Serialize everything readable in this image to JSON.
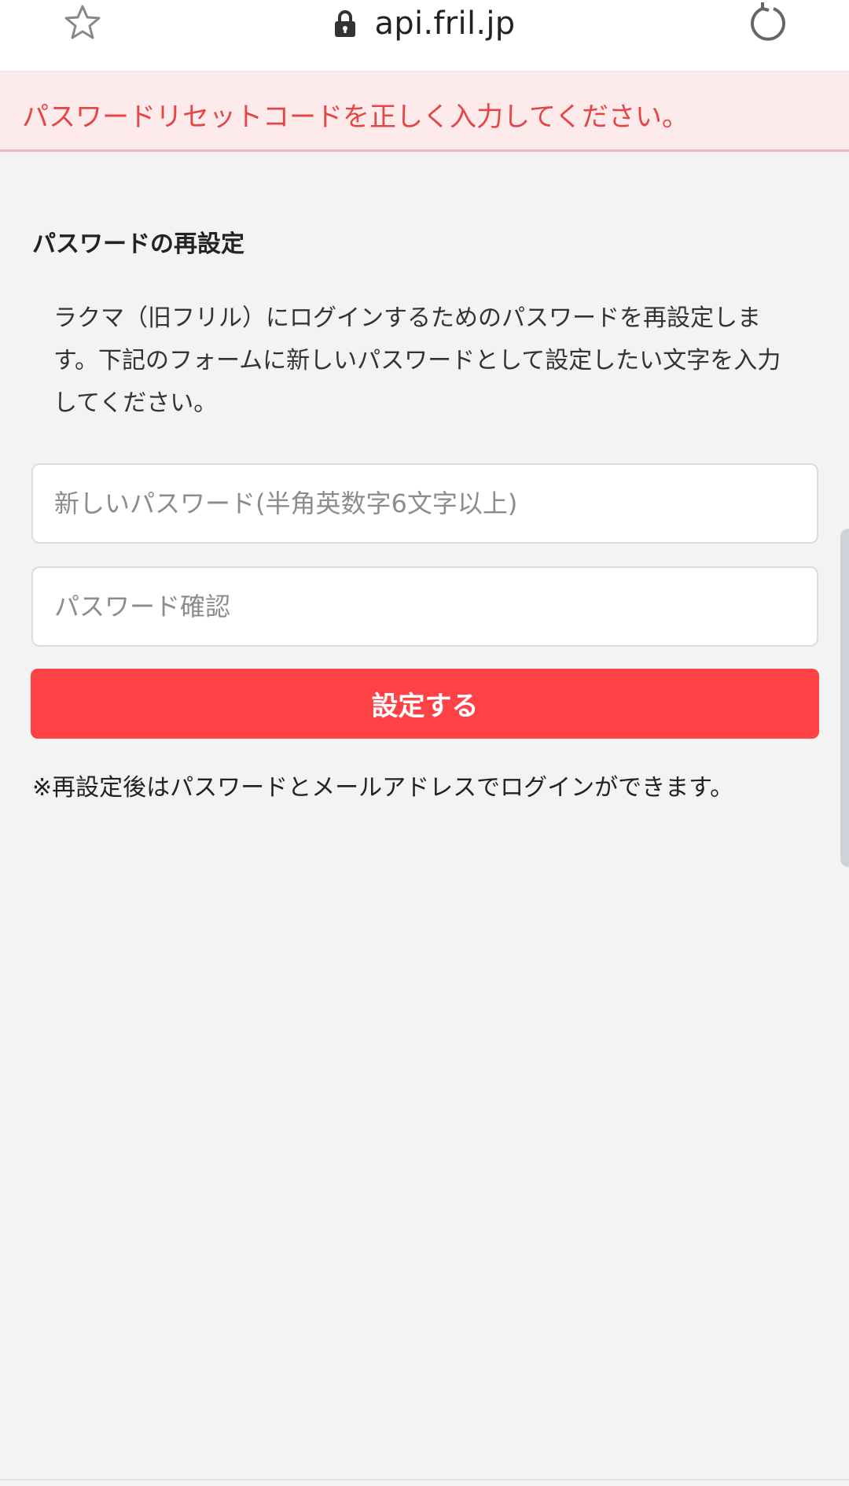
{
  "browser": {
    "url": "api.fril.jp",
    "icons": {
      "bookmark": "star-icon",
      "secure": "lock-icon",
      "reload": "reload-icon"
    }
  },
  "alert": {
    "message": "パスワードリセットコードを正しく入力してください。",
    "color": "#e64545",
    "background": "#fdeaea"
  },
  "form": {
    "title": "パスワードの再設定",
    "description": "ラクマ（旧フリル）にログインするためのパスワードを再設定します。下記のフォームに新しいパスワードとして設定したい文字を入力してください。",
    "new_password": {
      "value": "",
      "placeholder": "新しいパスワード(半角英数字6文字以上)"
    },
    "confirm_password": {
      "value": "",
      "placeholder": "パスワード確認"
    },
    "submit_label": "設定する",
    "submit_color": "#ff4245",
    "note": "※再設定後はパスワードとメールアドレスでログインができます。"
  }
}
